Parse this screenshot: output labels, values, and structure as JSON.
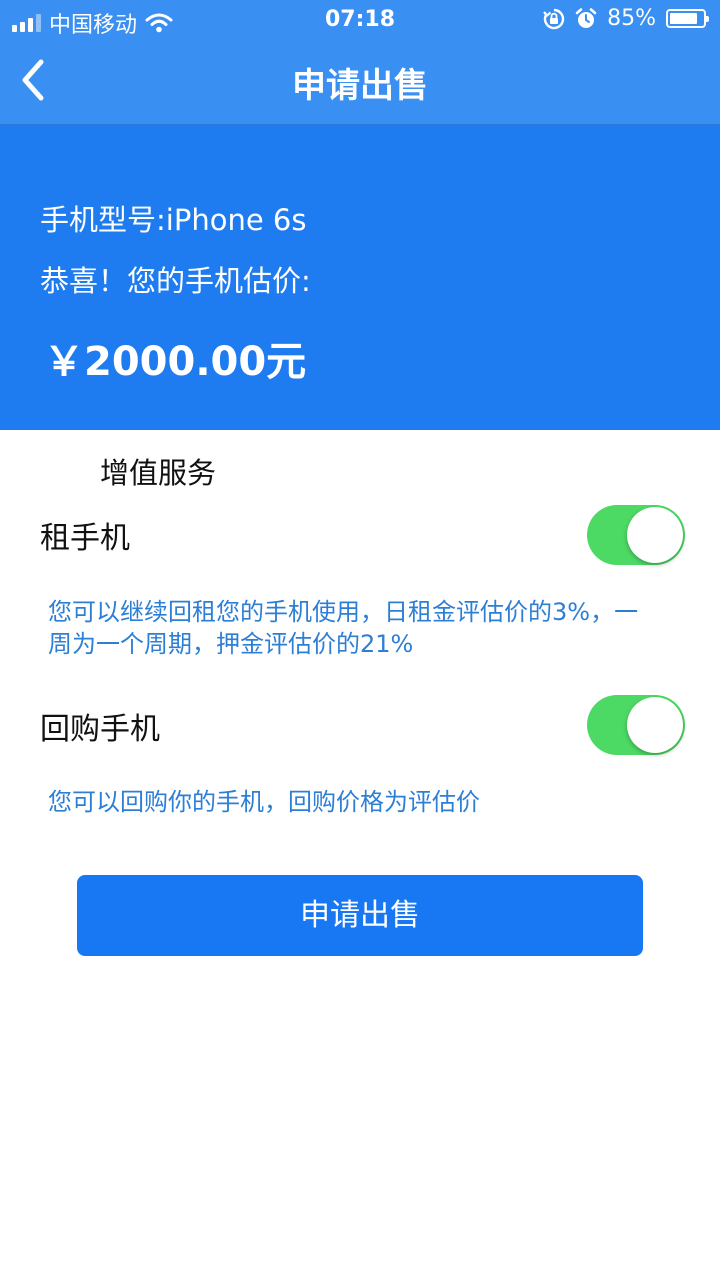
{
  "status_bar": {
    "carrier": "中国移动",
    "time": "07:18",
    "battery_text": "85%",
    "battery_level": 0.85,
    "icons": [
      "signal-icon",
      "wifi-icon",
      "rotation-lock-icon",
      "alarm-icon",
      "battery-icon"
    ]
  },
  "nav": {
    "title": "申请出售",
    "back_icon": "chevron-left-icon"
  },
  "price_card": {
    "model": "手机型号:iPhone 6s",
    "congrats": "恭喜！您的手机估价:",
    "price": "￥2000.00元"
  },
  "services": {
    "title": "增值服务",
    "items": [
      {
        "label": "租手机",
        "enabled": true,
        "description": "您可以继续回租您的手机使用，日租金评估价的3%，一周为一个周期，押金评估价的21%"
      },
      {
        "label": "回购手机",
        "enabled": true,
        "description": "您可以回购你的手机，回购价格为评估价"
      }
    ]
  },
  "submit": {
    "label": "申请出售"
  },
  "colors": {
    "header": "#3a8ff2",
    "card": "#1e7cf0",
    "toggle_on": "#4cd964",
    "button": "#1878f4",
    "description": "#2d7fd6"
  }
}
